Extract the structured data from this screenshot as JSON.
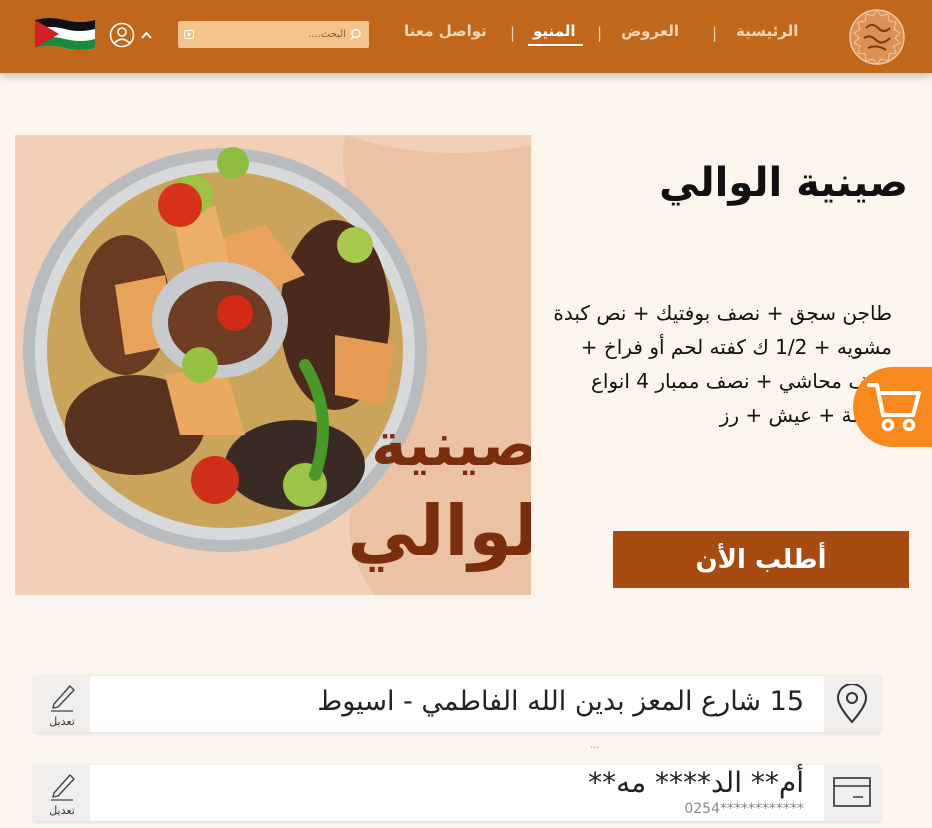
{
  "header": {
    "nav": {
      "home": "الرئيسية",
      "offers": "العروض",
      "menu": "المنيو",
      "contact": "تواصل معنا",
      "separator": "|"
    },
    "search_placeholder": "البحث....",
    "colors": {
      "bar": "#c0671c",
      "accent": "#f7891f"
    }
  },
  "product": {
    "title": "صينية الوالي",
    "description": "طاجن سجق + نصف بوفتيك + نص كبدة مشويه + 1/2 ك كفته لحم أو فراخ + نصف محاشي + نصف ممبار 4 انواع سلطة + عيش + رز",
    "image_caption_line1": "صينية",
    "image_caption_line2": "الوالي",
    "order_button": "أطلب الأن"
  },
  "address_card": {
    "text": "15 شارع المعز بدين الله الفاطمي - اسيوط",
    "edit_label": "تعديل"
  },
  "separator_dots": "...",
  "payment_card": {
    "name": "أم** الد**** مه**",
    "number": "************0254",
    "edit_label": "تعديل"
  }
}
